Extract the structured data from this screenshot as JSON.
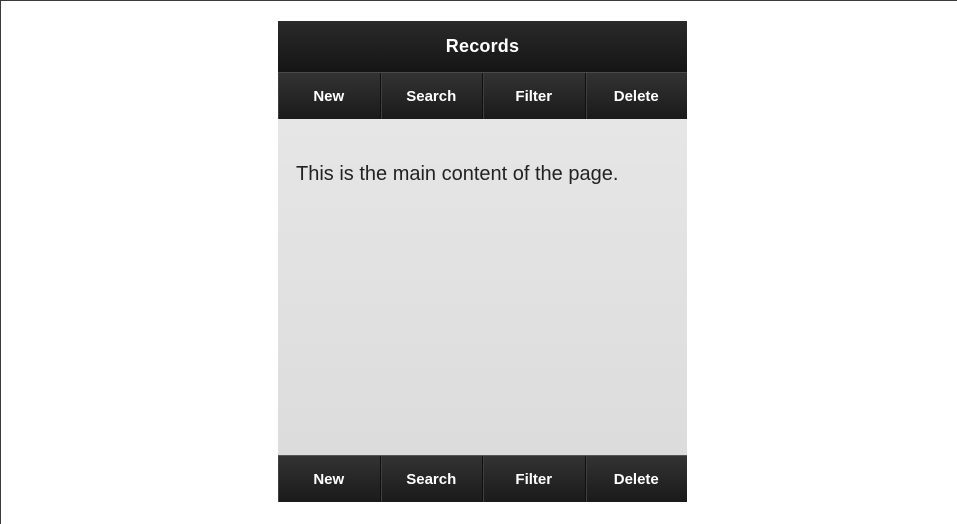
{
  "header": {
    "title": "Records"
  },
  "top_nav": [
    {
      "label": "New"
    },
    {
      "label": "Search"
    },
    {
      "label": "Filter"
    },
    {
      "label": "Delete"
    }
  ],
  "main": {
    "text": "This is the main content of the page."
  },
  "bottom_nav": [
    {
      "label": "New"
    },
    {
      "label": "Search"
    },
    {
      "label": "Filter"
    },
    {
      "label": "Delete"
    }
  ],
  "colors": {
    "bar": "#1e1e1e",
    "content_bg": "#e2e2e2",
    "text": "#222222"
  }
}
